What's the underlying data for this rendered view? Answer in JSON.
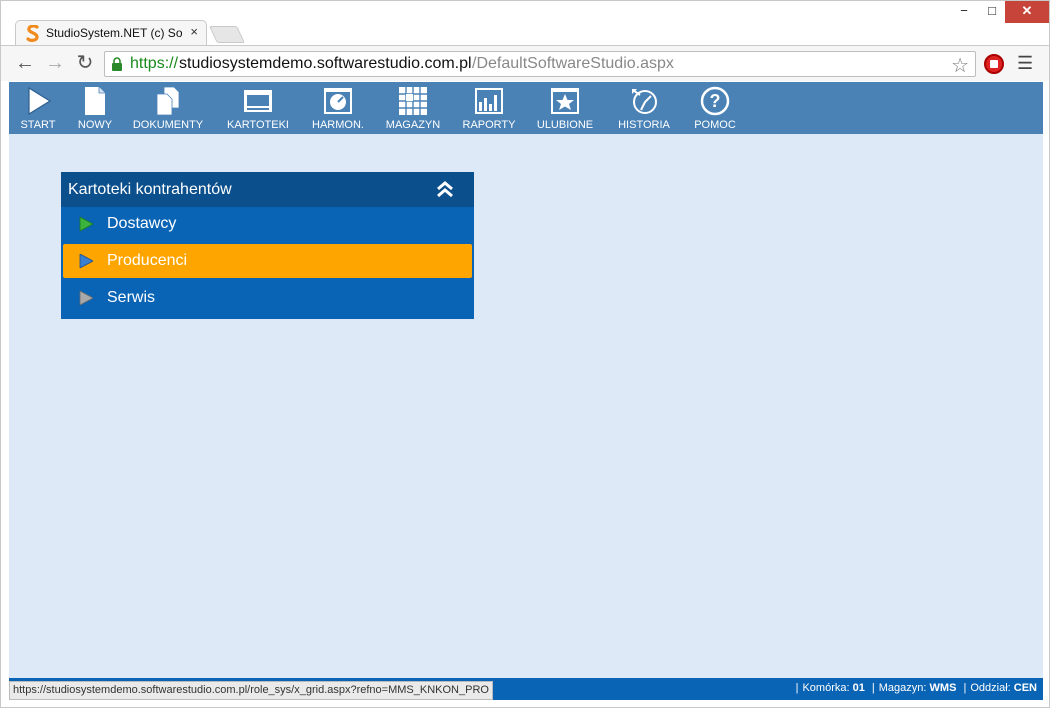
{
  "browser": {
    "tab_title": "StudioSystem.NET (c) Soft",
    "tab_close": "×",
    "url_scheme": "https://",
    "url_host": "studiosystemdemo.softwarestudio.com.pl",
    "url_path": "/DefaultSoftwareStudio.aspx",
    "window_controls": {
      "minimize": "−",
      "maximize": "□",
      "close": "✕"
    }
  },
  "app_menu": [
    {
      "label": "START",
      "icon": "play-icon"
    },
    {
      "label": "NOWY",
      "icon": "new-document-icon"
    },
    {
      "label": "DOKUMENTY",
      "icon": "documents-icon"
    },
    {
      "label": "KARTOTEKI",
      "icon": "cards-icon"
    },
    {
      "label": "HARMON.",
      "icon": "clock-icon"
    },
    {
      "label": "MAGAZYN",
      "icon": "warehouse-grid-icon"
    },
    {
      "label": "RAPORTY",
      "icon": "report-chart-icon"
    },
    {
      "label": "ULUBIONE",
      "icon": "star-icon"
    },
    {
      "label": "HISTORIA",
      "icon": "history-icon"
    },
    {
      "label": "POMOC",
      "icon": "help-icon"
    }
  ],
  "panel": {
    "title": "Kartoteki kontrahentów",
    "items": [
      {
        "label": "Dostawcy",
        "selected": false,
        "arrow_color": "#3cb33c"
      },
      {
        "label": "Producenci",
        "selected": true,
        "arrow_color": "#3a7fd0"
      },
      {
        "label": "Serwis",
        "selected": false,
        "arrow_color": "#a9a9a9"
      }
    ]
  },
  "status": {
    "hover_url": "https://studiosystemdemo.softwarestudio.com.pl/role_sys/x_grid.aspx?refno=MMS_KNKON_PRO",
    "komorka_label": "Komórka:",
    "komorka_value": "01",
    "magazyn_label": "Magazyn:",
    "magazyn_value": "WMS",
    "oddzial_label": "Oddział:",
    "oddzial_value": "CEN"
  },
  "colors": {
    "menu_bar": "#4a82b6",
    "panel_header": "#0b4f8c",
    "panel_body": "#0a64b5",
    "selected_item": "#ffa500",
    "content_bg": "#dde9f7"
  }
}
